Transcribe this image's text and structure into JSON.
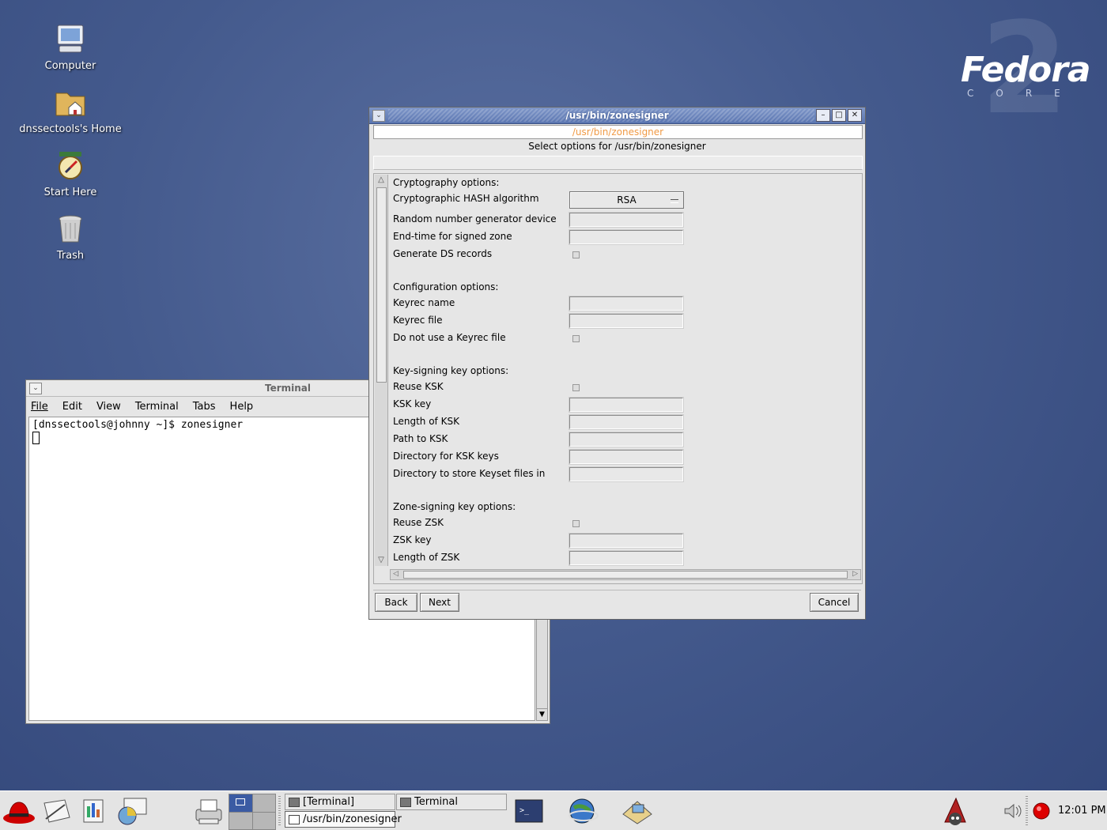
{
  "desktop": {
    "icons": [
      {
        "label": "Computer",
        "icon": "computer-icon"
      },
      {
        "label": "dnssectools's Home",
        "icon": "home-folder-icon"
      },
      {
        "label": "Start Here",
        "icon": "start-here-icon"
      },
      {
        "label": "Trash",
        "icon": "trash-icon"
      }
    ],
    "logo": {
      "word": "Fedora",
      "sub": "CORE",
      "num": "2"
    }
  },
  "terminal": {
    "title": "Terminal",
    "menu": [
      "File",
      "Edit",
      "View",
      "Terminal",
      "Tabs",
      "Help"
    ],
    "prompt_line": "[dnssectools@johnny ~]$ zonesigner"
  },
  "dialog": {
    "title": "/usr/bin/zonesigner",
    "subtitle": "/usr/bin/zonesigner",
    "heading": "Select options for /usr/bin/zonesigner",
    "sections": {
      "crypto": {
        "header": "Cryptography options:",
        "hash_label": "Cryptographic HASH algorithm",
        "hash_value": "RSA",
        "random_label": "Random number generator device",
        "endtime_label": "End-time for signed zone",
        "gends_label": "Generate DS records"
      },
      "config": {
        "header": "Configuration options:",
        "keyrec_name_label": "Keyrec name",
        "keyrec_file_label": "Keyrec file",
        "no_keyrec_label": "Do not use a Keyrec file"
      },
      "ksk": {
        "header": "Key-signing key options:",
        "reuse_label": "Reuse KSK",
        "key_label": "KSK key",
        "length_label": "Length of KSK",
        "path_label": "Path to KSK",
        "dir_label": "Directory for KSK keys",
        "keyset_dir_label": "Directory to store Keyset files in"
      },
      "zsk": {
        "header": "Zone-signing key options:",
        "reuse_label": "Reuse ZSK",
        "key_label": "ZSK key",
        "length_label": "Length of ZSK"
      }
    },
    "buttons": {
      "back": "Back",
      "next": "Next",
      "cancel": "Cancel"
    }
  },
  "taskbar": {
    "tasks": [
      {
        "label": "[Terminal]"
      },
      {
        "label": "Terminal"
      },
      {
        "label": "/usr/bin/zonesigner"
      }
    ],
    "clock": "12:01 PM"
  },
  "colors": {
    "desktop": "#445a8d",
    "title_active": "#5a75b0",
    "subtitle_text": "#f09a45"
  }
}
